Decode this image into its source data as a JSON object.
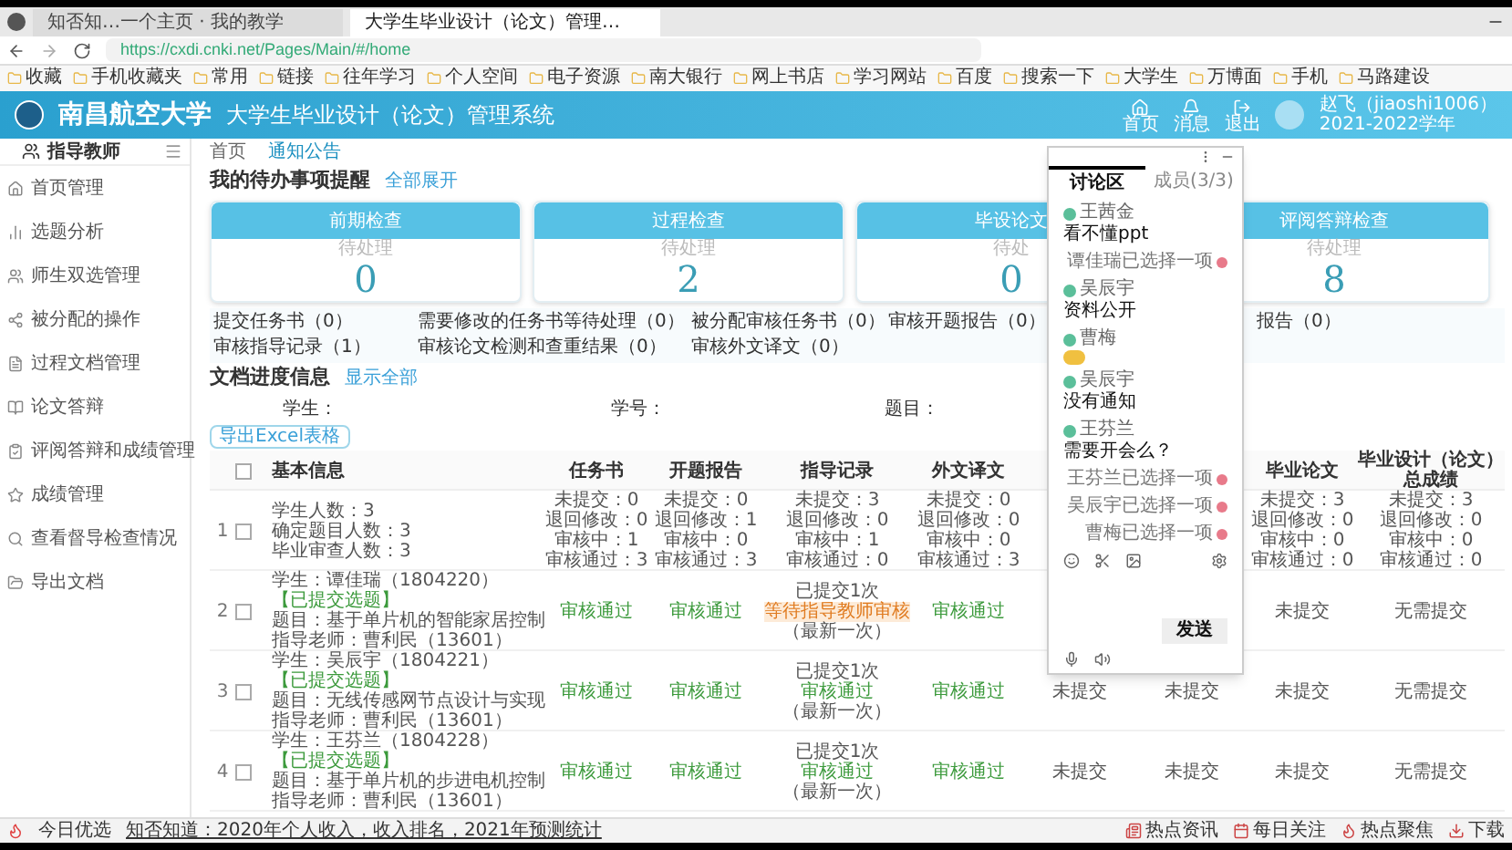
{
  "browser": {
    "tabs": [
      {
        "label": "知否知…一个主页 · 我的教学",
        "selected": false
      },
      {
        "label": "大学生毕业设计（论文）管理…",
        "selected": true
      }
    ],
    "url": "https://cxdi.cnki.net/Pages/Main/#/home",
    "bookmarks": [
      "收藏",
      "手机收藏夹",
      "常用",
      "链接",
      "往年学习",
      "个人空间",
      "电子资源",
      "南大银行",
      "网上书店",
      "学习网站",
      "百度",
      "搜索一下",
      "大学生",
      "万博面",
      "手机",
      "马路建设"
    ]
  },
  "app": {
    "school": "南昌航空大学",
    "system": "大学生毕业设计（论文）管理系统",
    "toolbar": [
      "首页",
      "消息",
      "退出"
    ],
    "user": "赵飞（jiaoshi1006）",
    "term": "2021-2022学年"
  },
  "sidebar": {
    "title": "指导教师",
    "items": [
      {
        "label": "首页管理",
        "selected": false
      },
      {
        "label": "选题分析",
        "selected": false
      },
      {
        "label": "师生双选管理",
        "selected": false
      },
      {
        "label": "被分配的操作",
        "selected": false
      },
      {
        "label": "过程文档管理",
        "selected": false
      },
      {
        "label": "论文答辩",
        "selected": false
      },
      {
        "label": "评阅答辩和成绩管理",
        "selected": false
      },
      {
        "label": "成绩管理",
        "selected": false
      },
      {
        "label": "查看督导检查情况",
        "selected": false
      },
      {
        "label": "导出文档",
        "selected": false
      }
    ]
  },
  "breadcrumb": [
    {
      "label": "首页",
      "selected": false
    },
    {
      "label": "通知公告",
      "selected": true
    }
  ],
  "todo": {
    "title": "我的待办事项提醒",
    "link": "全部展开",
    "cards": [
      {
        "title": "前期检查",
        "caption": "待处理",
        "value": "0"
      },
      {
        "title": "过程检查",
        "caption": "待处理",
        "value": "2"
      },
      {
        "title": "毕设论文",
        "caption": "待处",
        "value": "0"
      },
      {
        "title": "评阅答辩检查",
        "caption": "待处理",
        "value": "8"
      }
    ],
    "items": [
      "提交任务书（0）",
      "需要修改的任务书等待处理（0）",
      "被分配审核任务书（0）",
      "审核开题报告（0）",
      "报告（0）",
      "审核指导记录（1）",
      "审核论文检测和查重结果（0）",
      "审核外文译文（0）"
    ]
  },
  "progress": {
    "title": "文档进度信息",
    "link": "显示全部",
    "filters": [
      "学生：",
      "学号：",
      "题目："
    ],
    "export_button": "导出Excel表格",
    "select_all_checked": false,
    "columns": {
      "info": "基本信息",
      "task": "任务书",
      "proposal": "开题报告",
      "guidance": "指导记录",
      "translation": "外文译文",
      "thesis": "毕业论文",
      "final": "毕业设计（论文）总成绩"
    },
    "rows": [
      {
        "index": "1",
        "checked": false,
        "info": [
          {
            "text": "学生人数：3",
            "kind": "plain"
          },
          {
            "text": "确定题目人数：3",
            "kind": "plain"
          },
          {
            "text": "毕业审查人数：3",
            "kind": "plain"
          }
        ],
        "task": [
          "未提交：0",
          "退回修改：0",
          "审核中：1",
          "审核通过：3"
        ],
        "proposal": [
          "未提交：0",
          "退回修改：1",
          "审核中：0",
          "审核通过：3"
        ],
        "guidance": [
          "未提交：3",
          "退回修改：0",
          "审核中：1",
          "审核通过：0"
        ],
        "translation": [
          "未提交：0",
          "退回修改：0",
          "审核中：0",
          "审核通过：3"
        ],
        "thesis": [
          "未提交：3",
          "退回修改：0",
          "审核中：0",
          "审核通过：0"
        ],
        "final": [
          "未提交：3",
          "退回修改：0",
          "审核中：0",
          "审核通过：0"
        ]
      },
      {
        "index": "2",
        "checked": false,
        "info": [
          {
            "text": "学生：谭佳瑞（1804220）",
            "kind": "plain"
          },
          {
            "text": "【已提交选题】",
            "kind": "pass"
          },
          {
            "text": "题目：基于单片机的智能家居控制",
            "kind": "plain"
          },
          {
            "text": "指导老师：曹利民（13601）",
            "kind": "plain"
          }
        ],
        "task": [
          {
            "text": "审核通过",
            "kind": "pass"
          }
        ],
        "proposal": [
          {
            "text": "审核通过",
            "kind": "pass"
          }
        ],
        "guidance": [
          {
            "text": "已提交1次",
            "kind": "plain"
          },
          {
            "text": "等待指导教师审核",
            "kind": "pending"
          },
          {
            "text": "（最新一次）",
            "kind": "plain"
          }
        ],
        "translation": [
          {
            "text": "审核通过",
            "kind": "pass"
          }
        ],
        "thesis": [
          {
            "text": "未提交",
            "kind": "plain"
          }
        ],
        "final": [
          {
            "text": "无需提交",
            "kind": "plain"
          }
        ]
      },
      {
        "index": "3",
        "checked": false,
        "info": [
          {
            "text": "学生：吴辰宇（1804221）",
            "kind": "plain"
          },
          {
            "text": "【已提交选题】",
            "kind": "pass"
          },
          {
            "text": "题目：无线传感网节点设计与实现",
            "kind": "plain"
          },
          {
            "text": "指导老师：曹利民（13601）",
            "kind": "plain"
          }
        ],
        "task": [
          {
            "text": "审核通过",
            "kind": "pass"
          }
        ],
        "proposal": [
          {
            "text": "审核通过",
            "kind": "pass"
          }
        ],
        "guidance": [
          {
            "text": "已提交1次",
            "kind": "plain"
          },
          {
            "text": "审核通过",
            "kind": "pass"
          },
          {
            "text": "（最新一次）",
            "kind": "plain"
          }
        ],
        "translation": [
          {
            "text": "审核通过",
            "kind": "pass"
          }
        ],
        "column_6": [
          {
            "text": "未提交",
            "kind": "plain"
          }
        ],
        "column_7": [
          {
            "text": "未提交",
            "kind": "plain"
          }
        ],
        "thesis": [
          {
            "text": "未提交",
            "kind": "plain"
          }
        ],
        "final": [
          {
            "text": "无需提交",
            "kind": "plain"
          }
        ]
      },
      {
        "index": "4",
        "checked": false,
        "info": [
          {
            "text": "学生：王芬兰（1804228）",
            "kind": "plain"
          },
          {
            "text": "【已提交选题】",
            "kind": "pass"
          },
          {
            "text": "题目：基于单片机的步进电机控制",
            "kind": "plain"
          },
          {
            "text": "指导老师：曹利民（13601）",
            "kind": "plain"
          }
        ],
        "task": [
          {
            "text": "审核通过",
            "kind": "pass"
          }
        ],
        "proposal": [
          {
            "text": "审核通过",
            "kind": "pass"
          }
        ],
        "guidance": [
          {
            "text": "已提交1次",
            "kind": "plain"
          },
          {
            "text": "审核通过",
            "kind": "pass"
          },
          {
            "text": "（最新一次）",
            "kind": "plain"
          }
        ],
        "translation": [
          {
            "text": "审核通过",
            "kind": "pass"
          }
        ],
        "column_6": [
          {
            "text": "未提交",
            "kind": "plain"
          }
        ],
        "column_7": [
          {
            "text": "未提交",
            "kind": "plain"
          }
        ],
        "thesis": [
          {
            "text": "未提交",
            "kind": "plain"
          }
        ],
        "final": [
          {
            "text": "无需提交",
            "kind": "plain"
          }
        ]
      }
    ]
  },
  "chat": {
    "tabs": [
      {
        "label": "讨论区",
        "selected": true
      },
      {
        "label": "成员(3/3)",
        "selected": false
      }
    ],
    "messages": [
      {
        "kind": "message",
        "name": "王茜金",
        "text": "看不懂ppt"
      },
      {
        "kind": "notice",
        "text": "谭佳瑞已选择一项"
      },
      {
        "kind": "message",
        "name": "吴辰宇",
        "text": "资料公开"
      },
      {
        "kind": "sticker",
        "name": "曹梅"
      },
      {
        "kind": "message",
        "name": "吴辰宇",
        "text": "没有通知"
      },
      {
        "kind": "message",
        "name": "王芬兰",
        "text": "需要开会么？"
      },
      {
        "kind": "notice",
        "text": "王芬兰已选择一项"
      },
      {
        "kind": "notice",
        "text": "吴辰宇已选择一项"
      },
      {
        "kind": "notice",
        "text": "曹梅已选择一项"
      }
    ],
    "send_button": "发送"
  },
  "status_bar": {
    "left": "今日优选",
    "news": "知否知道：2020年个人收入，收入排名，2021年预测统计",
    "right": [
      "热点资讯",
      "每日关注",
      "热点聚焦",
      "下载"
    ]
  }
}
